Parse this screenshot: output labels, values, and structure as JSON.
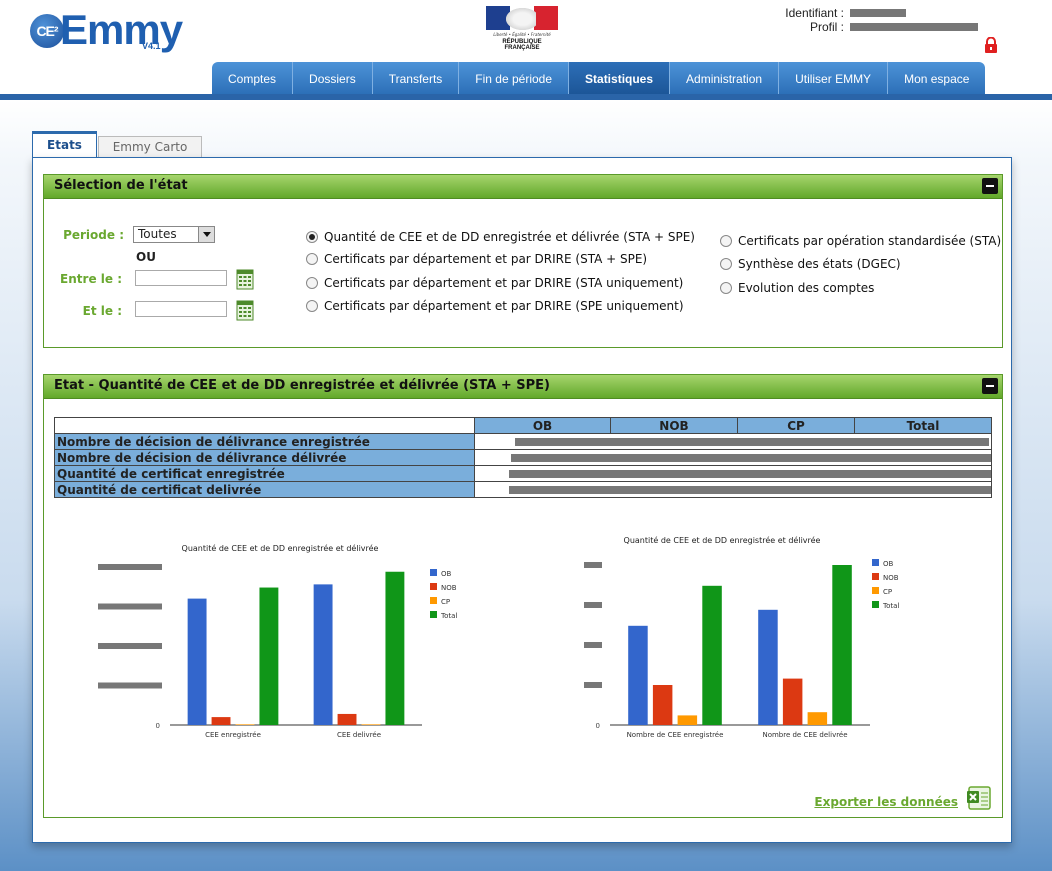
{
  "app": {
    "logo_prefix": "CE²",
    "logo_name": "Emmy",
    "version": "V4.1",
    "marianne_motto": "Liberté • Égalité • Fraternité",
    "marianne_rep": "RÉPUBLIQUE FRANÇAISE"
  },
  "user": {
    "identifiant_label": "Identifiant :",
    "profil_label": "Profil :"
  },
  "nav": {
    "tabs": [
      {
        "label": "Comptes"
      },
      {
        "label": "Dossiers"
      },
      {
        "label": "Transferts"
      },
      {
        "label": "Fin de période"
      },
      {
        "label": "Statistiques",
        "active": true
      },
      {
        "label": "Administration"
      },
      {
        "label": "Utiliser EMMY"
      },
      {
        "label": "Mon espace"
      }
    ]
  },
  "subtabs": [
    {
      "label": "Etats",
      "active": true
    },
    {
      "label": "Emmy Carto"
    }
  ],
  "selection": {
    "title": "Sélection de l'état",
    "periode_label": "Periode :",
    "periode_value": "Toutes",
    "ou_label": "OU",
    "entre_label": "Entre le :",
    "et_label": "Et le :",
    "entre_value": "",
    "et_value": "",
    "options_left": [
      {
        "label": "Quantité de CEE et de DD enregistrée et délivrée (STA + SPE)",
        "checked": true
      },
      {
        "label": "Certificats par département et par DRIRE (STA + SPE)"
      },
      {
        "label": "Certificats par département et par DRIRE (STA uniquement)"
      },
      {
        "label": "Certificats par département et par DRIRE (SPE uniquement)"
      }
    ],
    "options_right": [
      {
        "label": "Certificats par opération standardisée (STA)"
      },
      {
        "label": "Synthèse des états (DGEC)"
      },
      {
        "label": "Evolution des comptes"
      }
    ]
  },
  "etat": {
    "title": "Etat - Quantité de CEE et de DD enregistrée et délivrée (STA + SPE)",
    "columns": [
      "OB",
      "NOB",
      "CP",
      "Total"
    ],
    "rows": [
      {
        "label": "Nombre de décision de délivrance enregistrée"
      },
      {
        "label": "Nombre de décision de délivrance délivrée"
      },
      {
        "label": "Quantité de certificat enregistrée"
      },
      {
        "label": "Quantité de certificat delivrée"
      }
    ],
    "export_label": "Exporter les données"
  },
  "chart_data": [
    {
      "type": "bar",
      "title": "Quantité de CEE et de DD enregistrée et délivrée",
      "categories": [
        "CEE enregistrée",
        "CEE delivrée"
      ],
      "series": [
        {
          "name": "OB",
          "color": "#3366cc",
          "values": [
            0.8,
            0.89
          ]
        },
        {
          "name": "NOB",
          "color": "#dc3912",
          "values": [
            0.05,
            0.07
          ]
        },
        {
          "name": "CP",
          "color": "#ff9900",
          "values": [
            0.004,
            0.004
          ]
        },
        {
          "name": "Total",
          "color": "#109618",
          "values": [
            0.87,
            0.97
          ]
        }
      ],
      "ylim": [
        0,
        1
      ],
      "yticks": [
        "0"
      ],
      "legend": "right"
    },
    {
      "type": "bar",
      "title": "Quantité de CEE et de DD enregistrée et délivrée",
      "categories": [
        "Nombre de CEE enregistrée",
        "Nombre de CEE delivrée"
      ],
      "series": [
        {
          "name": "OB",
          "color": "#3366cc",
          "values": [
            0.62,
            0.72
          ]
        },
        {
          "name": "NOB",
          "color": "#dc3912",
          "values": [
            0.25,
            0.29
          ]
        },
        {
          "name": "CP",
          "color": "#ff9900",
          "values": [
            0.06,
            0.08
          ]
        },
        {
          "name": "Total",
          "color": "#109618",
          "values": [
            0.87,
            1.0
          ]
        }
      ],
      "ylim": [
        0,
        1
      ],
      "yticks": [
        "0"
      ],
      "legend": "right"
    }
  ]
}
